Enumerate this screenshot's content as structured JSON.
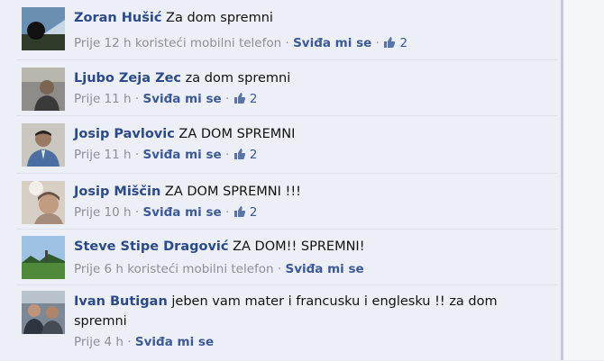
{
  "comments": [
    {
      "author": "Zoran Hušić",
      "text": "Za dom spremni",
      "time": "Prije 12 h",
      "via": "koristeći mobilni telefon",
      "like_label": "Sviđa mi se",
      "likes": "2",
      "avatar_icon": "landscape-avatar"
    },
    {
      "author": "Ljubo Zeja Zec",
      "text": "za dom spremni",
      "time": "Prije 11 h",
      "via": "",
      "like_label": "Sviđa mi se",
      "likes": "2",
      "avatar_icon": "person-avatar"
    },
    {
      "author": "Josip Pavlovic",
      "text": "ZA DOM SPREMNI",
      "time": "Prije 11 h",
      "via": "",
      "like_label": "Sviđa mi se",
      "likes": "2",
      "avatar_icon": "person-avatar"
    },
    {
      "author": "Josip Miščin",
      "text": "ZA DOM SPREMNI !!!",
      "time": "Prije 10 h",
      "via": "",
      "like_label": "Sviđa mi se",
      "likes": "2",
      "avatar_icon": "person-avatar"
    },
    {
      "author": "Steve Stipe Dragović",
      "text": "ZA DOM!! SPREMNI!",
      "time": "Prije 6 h",
      "via": "koristeći mobilni telefon",
      "like_label": "Sviđa mi se",
      "likes": "",
      "avatar_icon": "landscape-avatar"
    },
    {
      "author": "Ivan Butigan",
      "text": "jeben vam mater i francusku i englesku !! za dom spremni",
      "time": "Prije 4 h",
      "via": "",
      "like_label": "Sviđa mi se",
      "likes": "",
      "avatar_icon": "group-avatar"
    }
  ],
  "separator": "·",
  "icons": {
    "like": "thumbs-up-icon"
  },
  "colors": {
    "author": "#2b4a8b",
    "link": "#3b5998",
    "meta": "#8c8f96",
    "background": "#eceff5"
  }
}
